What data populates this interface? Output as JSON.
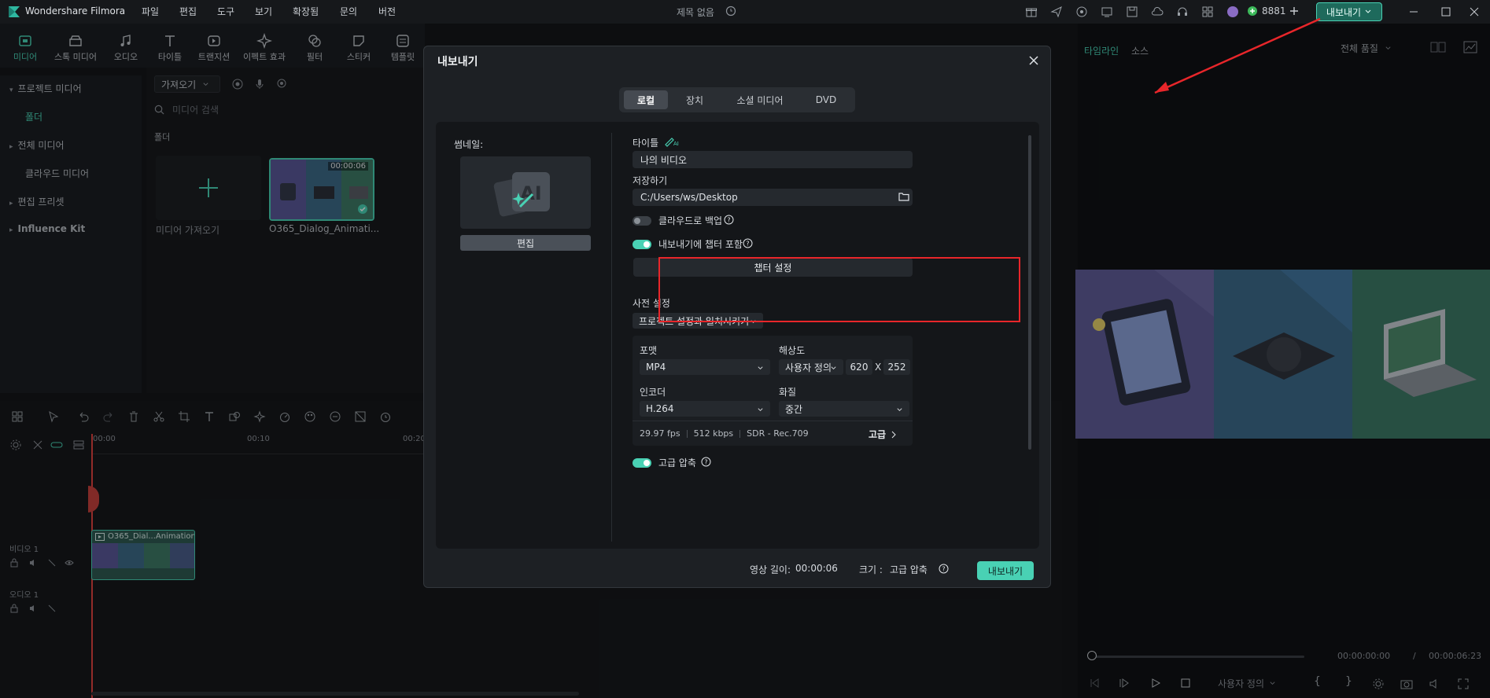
{
  "app": {
    "name": "Wondershare Filmora",
    "doc_title": "제목 없음",
    "credits": "8881",
    "export_label": "내보내기"
  },
  "menu": [
    "파일",
    "편집",
    "도구",
    "보기",
    "확장됨",
    "문의",
    "버전"
  ],
  "media_tools": [
    "미디어",
    "스톡 미디어",
    "오디오",
    "타이틀",
    "트랜지션",
    "이펙트 효과",
    "필터",
    "스티커",
    "템플릿"
  ],
  "sidebar": [
    "프로젝트 미디어",
    "폴더",
    "전체 미디어",
    "클라우드 미디어",
    "편집 프리셋",
    "Influence Kit"
  ],
  "media": {
    "import_dropdown": "가져오기",
    "search_placeholder": "미디어 검색",
    "folder_label": "폴더",
    "import_label": "미디어 가져오기",
    "clip_name": "O365_Dialog_Animati...",
    "clip_duration": "00:00:06"
  },
  "timeline": {
    "ticks": [
      "00:00",
      "00:10",
      "00:20"
    ],
    "track_video": "비디오 1",
    "track_audio": "오디오 1",
    "clip_label": "O365_Dial...Animation"
  },
  "preview": {
    "tab_timeline": "타임라인",
    "tab_source": "소스",
    "quality": "전체 품질",
    "time_current": "00:00:00:00",
    "time_sep": "/",
    "time_total": "00:00:06:23",
    "ratio": "사용자 정의"
  },
  "modal": {
    "title": "내보내기",
    "tabs": [
      "로컬",
      "장치",
      "소셜 미디어",
      "DVD"
    ],
    "thumbnail_label": "썸네일:",
    "edit_button": "편집",
    "title_label": "타이틀",
    "title_value": "나의 비디오",
    "save_label": "저장하기",
    "save_path": "C:/Users/ws/Desktop",
    "cloud_backup": "클라우드로 백업",
    "chapter_include": "내보내기에 챕터 포함",
    "chapter_settings": "챕터 설정",
    "preset_label": "사전 설정",
    "preset_value": "프로젝트 설정과 일치시키기",
    "format_label": "포맷",
    "format_value": "MP4",
    "resolution_label": "해상도",
    "resolution_value": "사용자 정의",
    "width": "620",
    "x": "X",
    "height": "252",
    "encoder_label": "인코더",
    "encoder_value": "H.264",
    "quality_label": "화질",
    "quality_value": "중간",
    "fps": "29.97 fps",
    "bitrate": "512 kbps",
    "sdr": "SDR - Rec.709",
    "advanced": "고급",
    "advanced_compress": "고급 압축",
    "duration_label": "영상 길이:",
    "duration_value": "00:00:06",
    "size_label": "크기 :",
    "size_value": "고급 압축",
    "export_button": "내보내기"
  },
  "colors": {
    "accent": "#49d1b4",
    "highlight": "#e8262a"
  }
}
